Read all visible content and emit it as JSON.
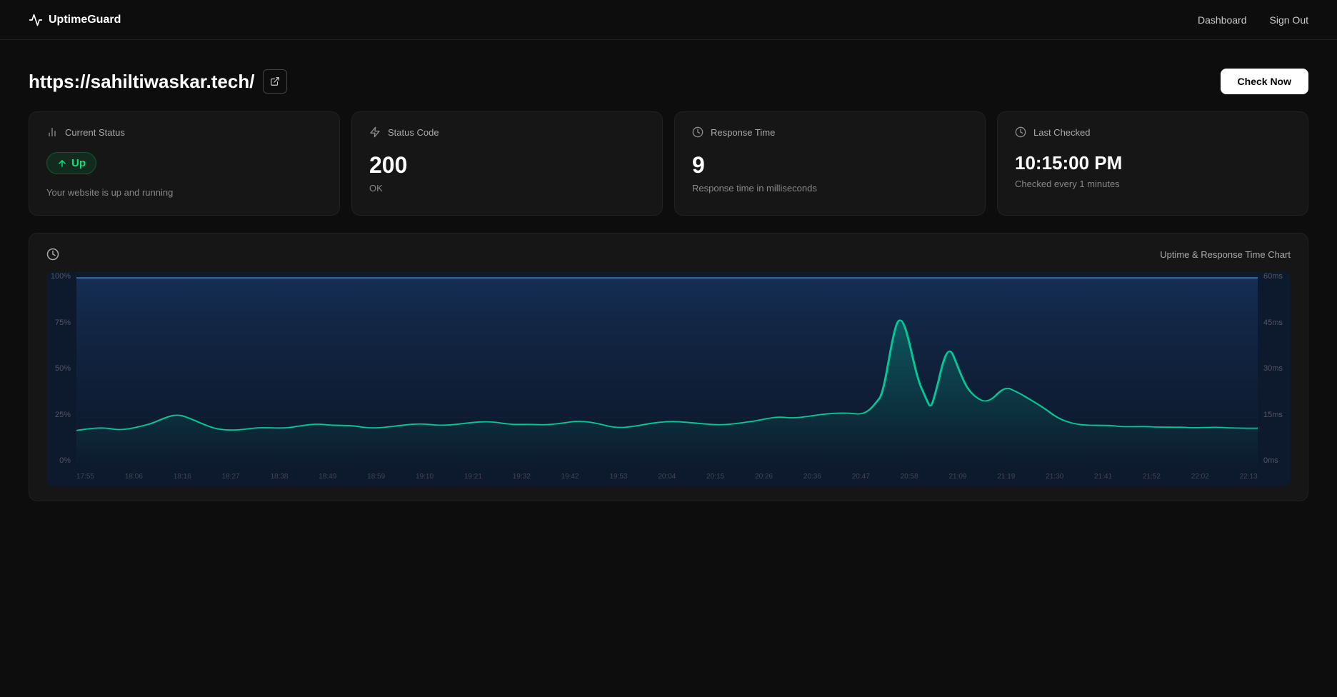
{
  "brand": {
    "name": "UptimeGuard",
    "icon": "activity-icon"
  },
  "nav": {
    "dashboard_label": "Dashboard",
    "signout_label": "Sign Out"
  },
  "url": {
    "address": "https://sahiltiwaskar.tech/",
    "external_link_label": "open external link"
  },
  "check_now_button": "Check Now",
  "cards": {
    "current_status": {
      "header_label": "Current Status",
      "status": "Up",
      "status_text": "Your website is up and running",
      "icon": "bar-chart-icon"
    },
    "status_code": {
      "header_label": "Status Code",
      "value": "200",
      "sub": "OK",
      "icon": "bolt-icon"
    },
    "response_time": {
      "header_label": "Response Time",
      "value": "9",
      "sub": "Response time in milliseconds",
      "icon": "clock-icon"
    },
    "last_checked": {
      "header_label": "Last Checked",
      "value": "10:15:00 PM",
      "sub": "Checked every 1 minutes",
      "icon": "clock-icon"
    }
  },
  "chart": {
    "title": "Uptime & Response Time Chart",
    "icon": "clock-icon",
    "y_axis_left": [
      "100%",
      "75%",
      "50%",
      "25%",
      "0%"
    ],
    "y_axis_right": [
      "60ms",
      "45ms",
      "30ms",
      "15ms",
      "0ms"
    ],
    "x_axis": [
      "17:55",
      "18:06",
      "18:16",
      "18:27",
      "18:38",
      "18:49",
      "18:59",
      "19:10",
      "19:21",
      "19:32",
      "19:42",
      "19:53",
      "20:04",
      "20:15",
      "20:26",
      "20:36",
      "20:47",
      "20:58",
      "21:09",
      "21:19",
      "21:30",
      "21:41",
      "21:52",
      "22:02",
      "22:13"
    ]
  }
}
